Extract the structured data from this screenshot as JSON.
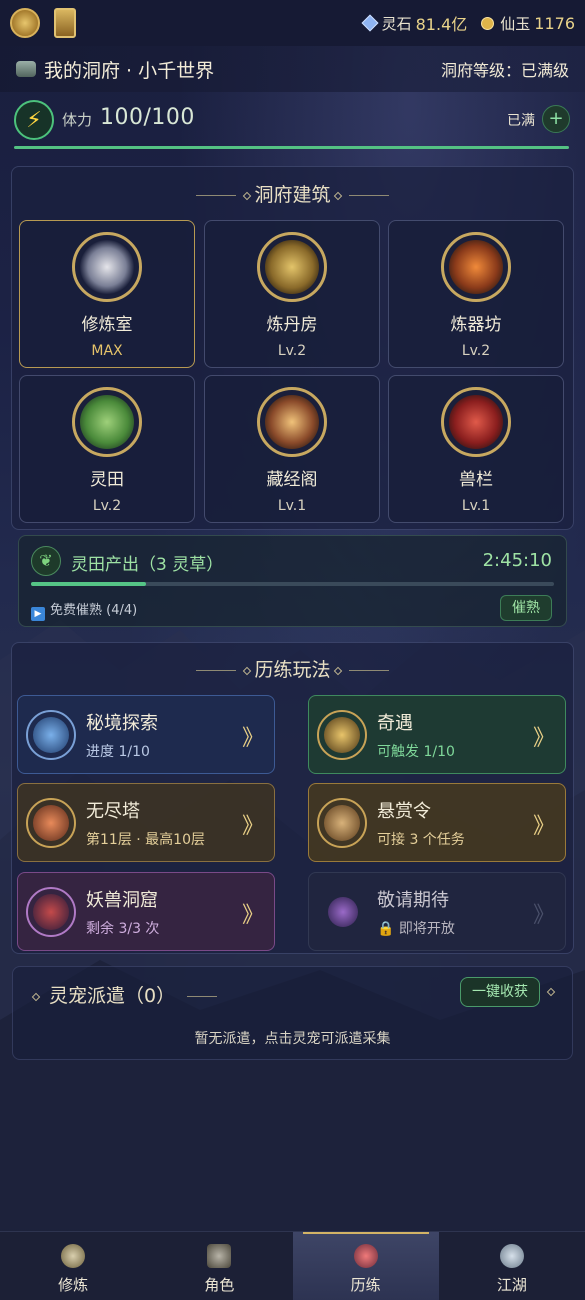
{
  "topbar": {
    "lingshi_label": "灵石",
    "lingshi_value": "81.4亿",
    "xianyu_label": "仙玉",
    "xianyu_value": "1176"
  },
  "header": {
    "title": "我的洞府 · 小千世界",
    "level_text": "洞府等级：已满级"
  },
  "stamina": {
    "label": "体力",
    "value": "100/100",
    "full_text": "已满",
    "plus": "+",
    "fill_fraction": 1.0
  },
  "buildings": {
    "title": "洞府建筑",
    "items": [
      {
        "name": "修炼室",
        "level": "MAX"
      },
      {
        "name": "炼丹房",
        "level": "Lv.2"
      },
      {
        "name": "炼器坊",
        "level": "Lv.2"
      },
      {
        "name": "灵田",
        "level": "Lv.2"
      },
      {
        "name": "藏经阁",
        "level": "Lv.1"
      },
      {
        "name": "兽栏",
        "level": "Lv.1"
      }
    ]
  },
  "farm": {
    "title": "灵田产出（3 灵草）",
    "timer": "2:45:10",
    "progress_fraction": 0.22,
    "free_text": "免费催熟 (4/4)",
    "button": "催熟"
  },
  "training": {
    "title": "历练玩法",
    "items": [
      {
        "name": "秘境探索",
        "sub": "进度 1/10"
      },
      {
        "name": "奇遇",
        "sub": "可触发 1/10"
      },
      {
        "name": "无尽塔",
        "sub": "第11层 · 最高10层"
      },
      {
        "name": "悬赏令",
        "sub": "可接 3 个任务"
      },
      {
        "name": "妖兽洞窟",
        "sub": "剩余 3/3 次"
      },
      {
        "name": "敬请期待",
        "sub": "即将开放"
      }
    ],
    "arrow": "》"
  },
  "pets": {
    "title": "灵宠派遣（0）",
    "button": "一键收获",
    "empty_msg": "暂无派遣，点击灵宠可派遣采集"
  },
  "nav": [
    {
      "label": "修炼"
    },
    {
      "label": "角色"
    },
    {
      "label": "历练"
    },
    {
      "label": "江湖"
    }
  ]
}
